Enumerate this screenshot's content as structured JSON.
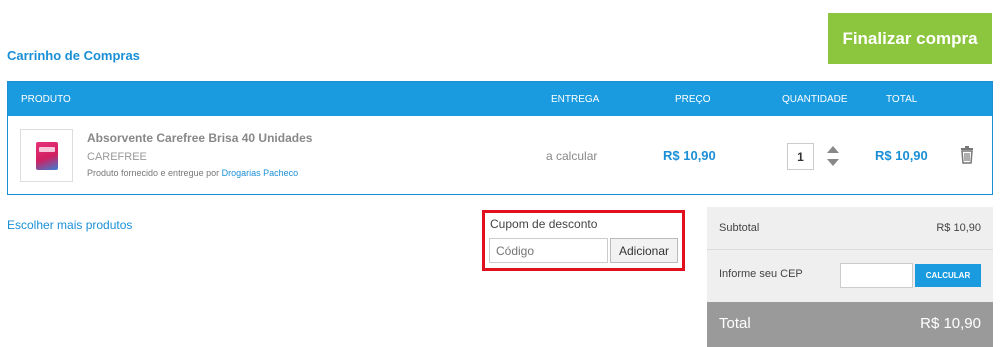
{
  "header": {
    "title": "Carrinho de Compras",
    "finish_label": "Finalizar compra"
  },
  "table": {
    "columns": {
      "product": "PRODUTO",
      "delivery": "ENTREGA",
      "price": "PREÇO",
      "quantity": "QUANTIDADE",
      "total": "TOTAL"
    },
    "item": {
      "name": "Absorvente Carefree Brisa 40 Unidades",
      "brand": "CAREFREE",
      "seller_prefix": "Produto fornecido e entregue por",
      "seller_name": "Drogarias Pacheco",
      "delivery": "a calcular",
      "price": "R$ 10,90",
      "quantity": "1",
      "total": "R$ 10,90"
    }
  },
  "links": {
    "more_products": "Escolher mais produtos"
  },
  "coupon": {
    "title": "Cupom de desconto",
    "placeholder": "Código",
    "button_label": "Adicionar"
  },
  "summary": {
    "subtotal_label": "Subtotal",
    "subtotal_value": "R$ 10,90",
    "cep_label": "Informe seu CEP",
    "cep_button": "CALCULAR",
    "total_label": "Total",
    "total_value": "R$ 10,90"
  },
  "colors": {
    "accent_blue": "#1a9be0",
    "finish_green": "#8cc63f",
    "highlight_red": "#e0101f",
    "total_bar": "#9a9a9a"
  },
  "icons": {
    "product_image": "product-thumbnail",
    "quantity_up": "chevron-up-icon",
    "quantity_down": "chevron-down-icon",
    "remove": "trash-icon"
  }
}
